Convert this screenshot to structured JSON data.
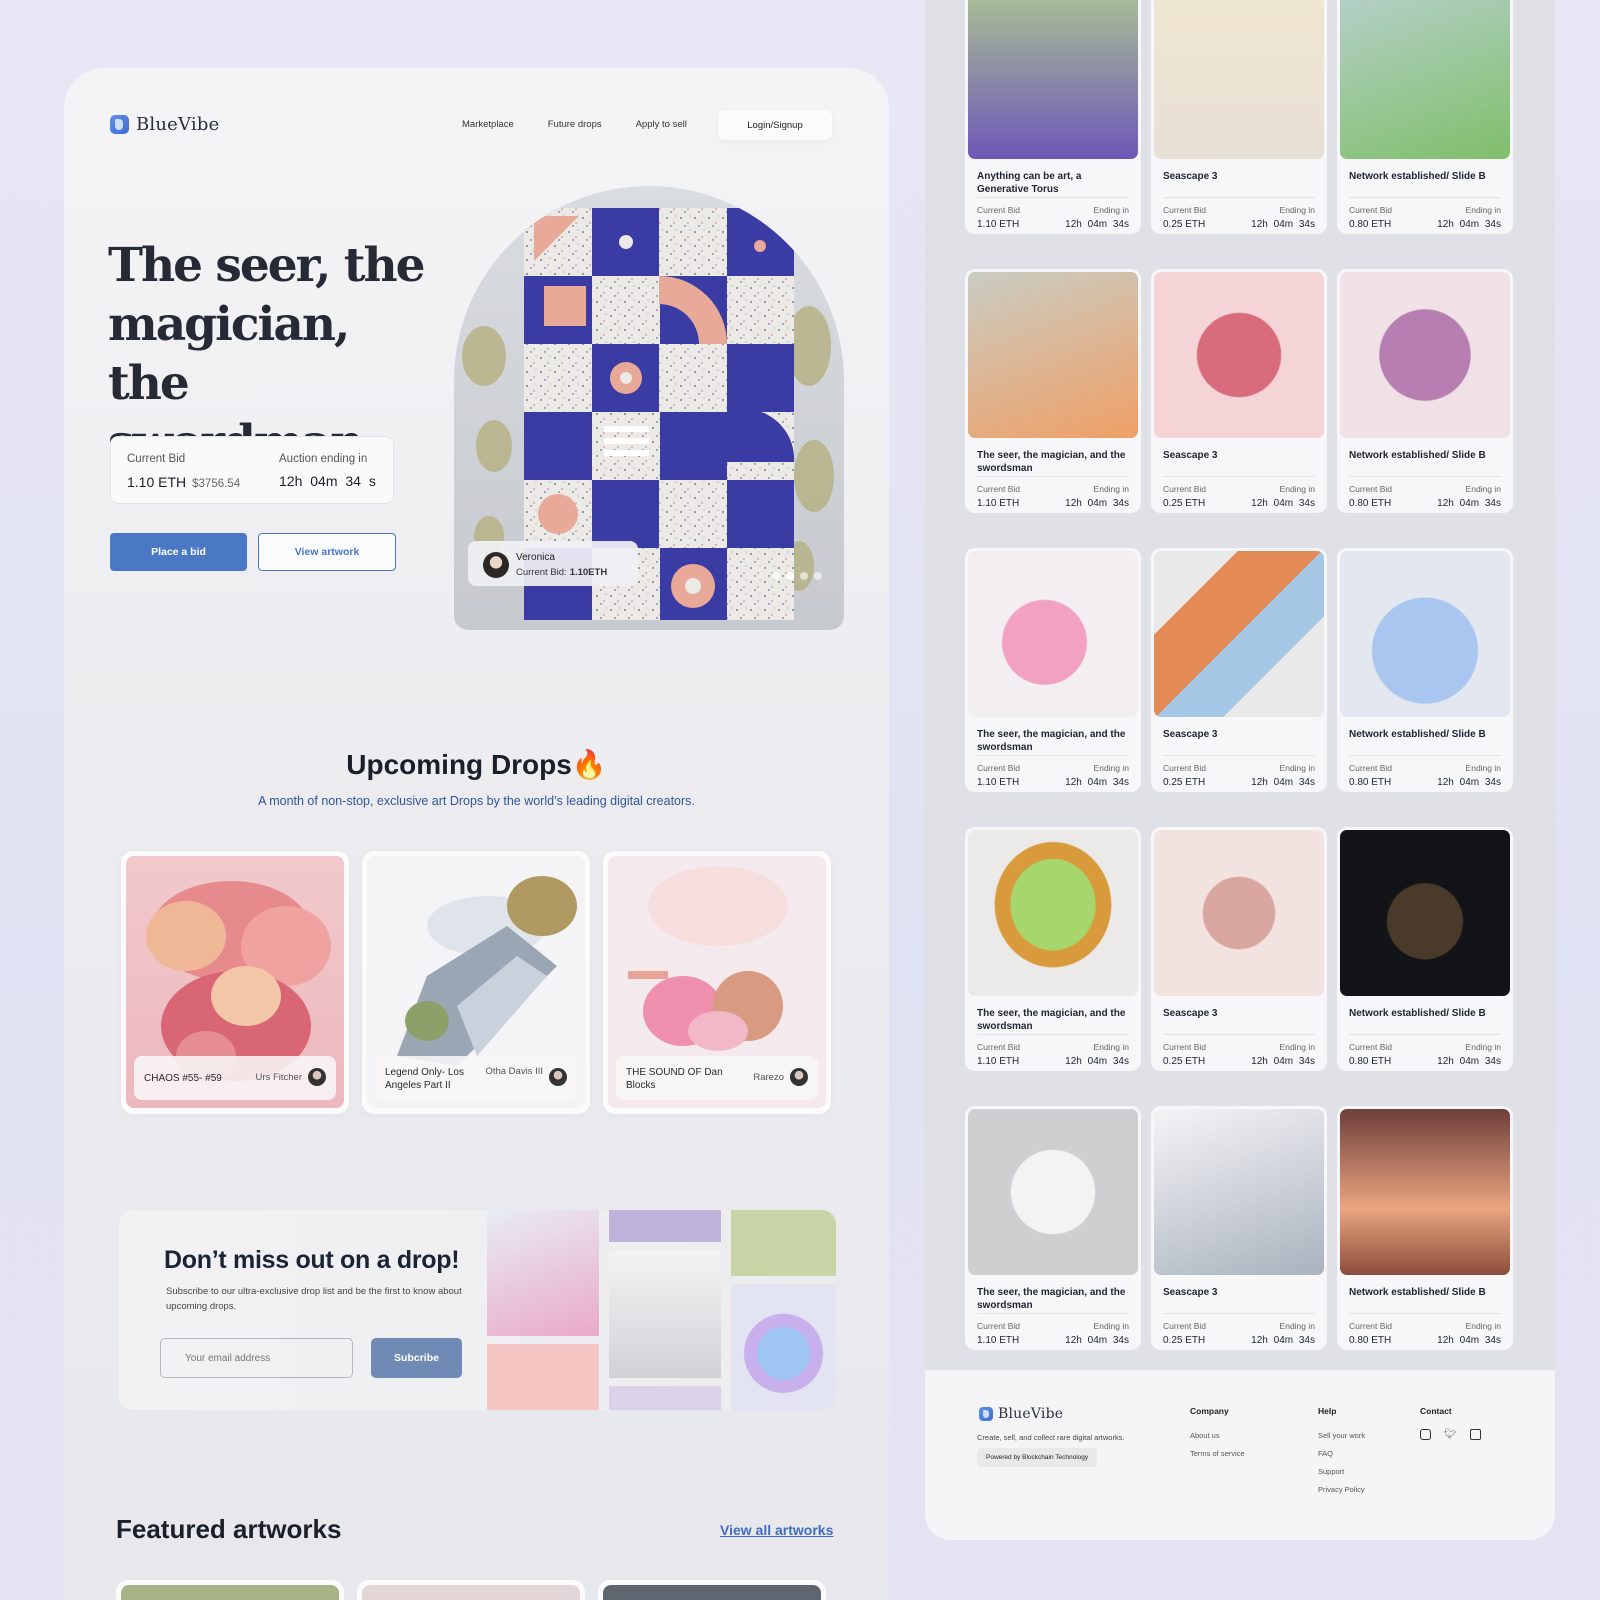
{
  "brand": "BlueVibe",
  "nav": {
    "links": [
      "Marketplace",
      "Future drops",
      "Apply to sell"
    ],
    "login": "Login/Signup"
  },
  "hero": {
    "title": "The seer, the magician, the swordman",
    "current_bid_label": "Current Bid",
    "current_bid_value": "1.10 ETH",
    "current_bid_usd": "$3756.54",
    "auction_label": "Auction ending in",
    "auction_value": "12h  04m  34 s",
    "place_bid": "Place a bid",
    "view_artwork": "View artwork",
    "card": {
      "name": "Veronica",
      "bid_label": "Current Bid:",
      "bid_value": "1.10ETH"
    },
    "slider_dots": 4,
    "active_dot": 1
  },
  "upcoming": {
    "title": "Upcoming Drops",
    "emoji": "🔥",
    "subtitle": "A month of non-stop, exclusive art Drops by the world’s leading digital creators.",
    "drops": [
      {
        "title": "CHAOS #55- #59",
        "artist": "Urs Fitcher"
      },
      {
        "title": "Legend Only- Los Angeles Part II",
        "artist": "Otha Davis III"
      },
      {
        "title": "THE SOUND OF Dan Blocks",
        "artist": "Rarezo"
      }
    ]
  },
  "subscribe": {
    "title": "Don’t miss out on a drop!",
    "text": "Subscribe to our ultra-exclusive drop list and be the first to know about upcoming drops.",
    "placeholder": "Your email address",
    "button": "Subcribe"
  },
  "featured": {
    "title": "Featured artworks",
    "link": "View all artworks"
  },
  "grid_labels": {
    "current_bid": "Current Bid",
    "ending": "Ending in"
  },
  "grid": [
    {
      "title": "Anything can be art, a Generative Torus",
      "bid": "1.10 ETH",
      "time": "12h 04m 34s"
    },
    {
      "title": "Seascape 3",
      "bid": "0.25 ETH",
      "time": "12h 04m 34s"
    },
    {
      "title": "Network established/ Slide B",
      "bid": "0.80 ETH",
      "time": "12h 04m 34s"
    },
    {
      "title": "The seer, the magician, and the swordsman",
      "bid": "1.10 ETH",
      "time": "12h 04m 34s"
    },
    {
      "title": "Seascape 3",
      "bid": "0.25 ETH",
      "time": "12h 04m 34s"
    },
    {
      "title": "Network established/ Slide B",
      "bid": "0.80 ETH",
      "time": "12h 04m 34s"
    },
    {
      "title": "The seer, the magician, and the swordsman",
      "bid": "1.10 ETH",
      "time": "12h 04m 34s"
    },
    {
      "title": "Seascape 3",
      "bid": "0.25 ETH",
      "time": "12h 04m 34s"
    },
    {
      "title": "Network established/ Slide B",
      "bid": "0.80 ETH",
      "time": "12h 04m 34s"
    },
    {
      "title": "The seer, the magician, and the swordsman",
      "bid": "1.10 ETH",
      "time": "12h 04m 34s"
    },
    {
      "title": "Seascape 3",
      "bid": "0.25 ETH",
      "time": "12h 04m 34s"
    },
    {
      "title": "Network established/ Slide B",
      "bid": "0.80 ETH",
      "time": "12h 04m 34s"
    },
    {
      "title": "The seer, the magician, and the swordsman",
      "bid": "1.10 ETH",
      "time": "12h 04m 34s"
    },
    {
      "title": "Seascape 3",
      "bid": "0.25 ETH",
      "time": "12h 04m 34s"
    },
    {
      "title": "Network established/ Slide B",
      "bid": "0.80 ETH",
      "time": "12h 04m 34s"
    }
  ],
  "footer": {
    "brand": "BlueVibe",
    "tagline": "Create, sell, and collect rare digital artworks.",
    "powered": "Powered by Blockchain Technology",
    "company": {
      "title": "Company",
      "items": [
        "About us",
        "Terms of service"
      ]
    },
    "help": {
      "title": "Help",
      "items": [
        "Sell your work",
        "FAQ",
        "Support",
        "Privacy Policy"
      ]
    },
    "contact": {
      "title": "Contact",
      "icons": [
        "instagram-icon",
        "twitter-icon",
        "chat-icon"
      ]
    }
  },
  "colors": {
    "accent": "#4a78c4",
    "subscribe": "#6e8ab5",
    "link": "#3e6cc1",
    "subtitle": "#2f5597"
  }
}
